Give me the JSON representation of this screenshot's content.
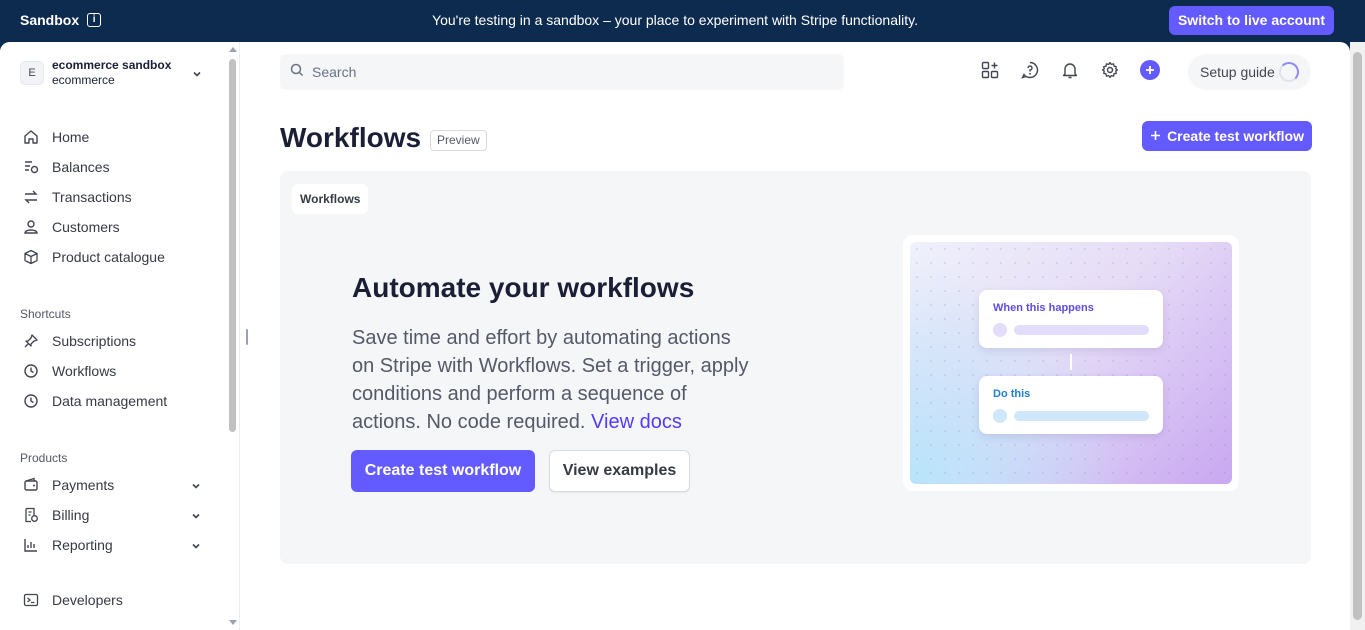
{
  "banner": {
    "sandbox_label": "Sandbox",
    "info_glyph": "i",
    "message": "You're testing in a sandbox – your place to experiment with Stripe functionality.",
    "switch_button": "Switch to live account"
  },
  "account": {
    "avatar_letter": "E",
    "name": "ecommerce sandbox",
    "subname": "ecommerce"
  },
  "sidebar": {
    "main_items": [
      {
        "label": "Home",
        "icon": "home-icon"
      },
      {
        "label": "Balances",
        "icon": "balances-icon"
      },
      {
        "label": "Transactions",
        "icon": "transactions-icon"
      },
      {
        "label": "Customers",
        "icon": "customers-icon"
      },
      {
        "label": "Product catalogue",
        "icon": "product-catalogue-icon"
      }
    ],
    "shortcuts_title": "Shortcuts",
    "shortcuts": [
      {
        "label": "Subscriptions",
        "icon": "pin-icon"
      },
      {
        "label": "Workflows",
        "icon": "clock-icon"
      },
      {
        "label": "Data management",
        "icon": "clock-icon"
      }
    ],
    "products_title": "Products",
    "products": [
      {
        "label": "Payments",
        "icon": "wallet-icon"
      },
      {
        "label": "Billing",
        "icon": "billing-icon"
      },
      {
        "label": "Reporting",
        "icon": "reporting-icon"
      }
    ],
    "developers": {
      "label": "Developers",
      "icon": "terminal-icon"
    }
  },
  "header": {
    "search_placeholder": "Search",
    "setup_guide": "Setup guide"
  },
  "page": {
    "title": "Workflows",
    "badge": "Preview",
    "create_button": "Create test workflow"
  },
  "panel": {
    "tag": "Workflows",
    "headline": "Automate your workflows",
    "description": "Save time and effort by automating actions on Stripe with Workflows. Set a trigger, apply conditions and perform a sequence of actions. No code required.",
    "docs_link": "View docs",
    "primary_button": "Create test workflow",
    "secondary_button": "View examples",
    "illustration": {
      "card1_title": "When this happens",
      "card2_title": "Do this"
    }
  },
  "colors": {
    "brand": "#635bff",
    "banner_bg": "#0d2b4f",
    "link": "#533afd"
  }
}
